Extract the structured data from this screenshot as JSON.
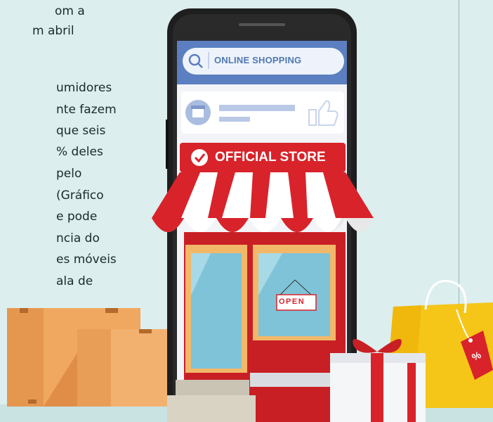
{
  "article": {
    "lines": [
      "om a",
      "m abril",
      "",
      "umidores",
      "nte fazem",
      "que seis",
      "% deles",
      "pelo",
      "(Gráfico",
      "e pode",
      "ncia do",
      "es móveis",
      "ala de"
    ]
  },
  "phone": {
    "search_placeholder": "ONLINE SHOPPING",
    "store_banner": "OFFICIAL STORE",
    "door_sign": "OPEN"
  },
  "shopping_bag": {
    "tag_label": "%"
  },
  "colors": {
    "background": "#dceeee",
    "phone_body": "#1e1e1e",
    "search_bar": "#5b7fc0",
    "store_red": "#d8232a",
    "awning_white": "#ffffff",
    "box": "#f0a860",
    "bag": "#f5c518"
  }
}
